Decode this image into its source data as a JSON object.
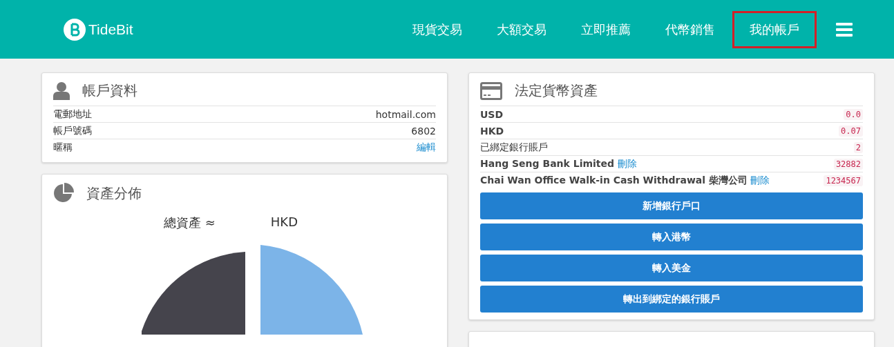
{
  "header": {
    "logo_text": "TideBit",
    "nav": [
      {
        "label": "現貨交易",
        "highlighted": false
      },
      {
        "label": "大額交易",
        "highlighted": false
      },
      {
        "label": "立即推薦",
        "highlighted": false
      },
      {
        "label": "代幣銷售",
        "highlighted": false
      },
      {
        "label": "我的帳戶",
        "highlighted": true
      }
    ]
  },
  "account_card": {
    "title": "帳戶資料",
    "rows": [
      {
        "label": "電郵地址",
        "value": "hotmail.com",
        "kind": "text"
      },
      {
        "label": "帳戶號碼",
        "value": "6802",
        "kind": "text"
      },
      {
        "label": "暱稱",
        "value": "編輯",
        "kind": "link"
      }
    ]
  },
  "distribution_card": {
    "title": "資產分佈",
    "total_label": "總資產 ≈",
    "total_currency": "HKD"
  },
  "fiat_card": {
    "title": "法定貨幣資產",
    "rows": [
      {
        "label": "USD",
        "value": "0.0",
        "bold": true
      },
      {
        "label": "HKD",
        "value": "0.07",
        "bold": true
      },
      {
        "label": "已綁定銀行賬戶",
        "value": "2",
        "bold": false
      },
      {
        "label": "Hang Seng Bank Limited",
        "action": "刪除",
        "value": "32882",
        "bold": true
      },
      {
        "label": "Chai Wan Office Walk-in Cash Withdrawal 柴灣公司",
        "action": "刪除",
        "value": "1234567",
        "bold": true
      }
    ],
    "buttons": [
      "新增銀行戶口",
      "轉入港幣",
      "轉入美金",
      "轉出到綁定的銀行賬戶"
    ]
  }
}
